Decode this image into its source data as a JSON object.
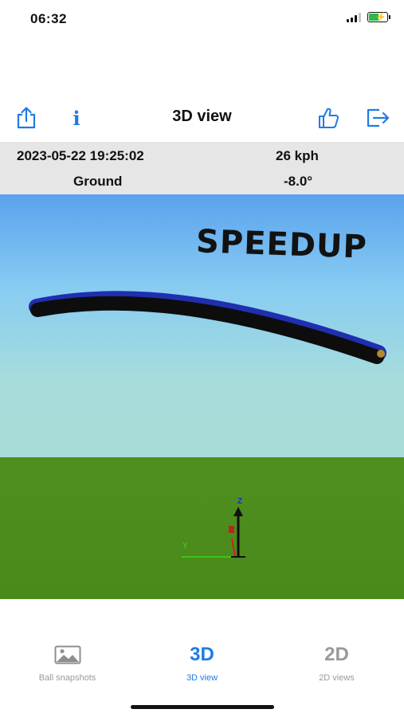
{
  "status_bar": {
    "time": "06:32"
  },
  "nav": {
    "title": "3D view",
    "share_icon": "share-icon",
    "info_label": "i",
    "like_icon": "thumbs-up-icon",
    "exit_icon": "exit-icon"
  },
  "info_panel": {
    "datetime": "2023-05-22 19:25:02",
    "speed": "26 kph",
    "surface": "Ground",
    "angle": "-8.0°"
  },
  "scene": {
    "overlay_text": "SPEEDUP",
    "axis_z": "Z",
    "axis_y": "Y"
  },
  "tabs": [
    {
      "label": "Ball snapshots",
      "icon": "image-icon"
    },
    {
      "label": "3D view",
      "glyph": "3D",
      "active": true
    },
    {
      "label": "2D views",
      "glyph": "2D"
    }
  ],
  "colors": {
    "accent": "#1f7be6",
    "inactive": "#9a9a9a",
    "sky_top": "#5aa2ee",
    "sky_bottom": "#a9dcd9",
    "grass": "#4c8a1d",
    "trajectory": "#0d0d0d",
    "trajectory_edge": "#1f2fb0"
  }
}
